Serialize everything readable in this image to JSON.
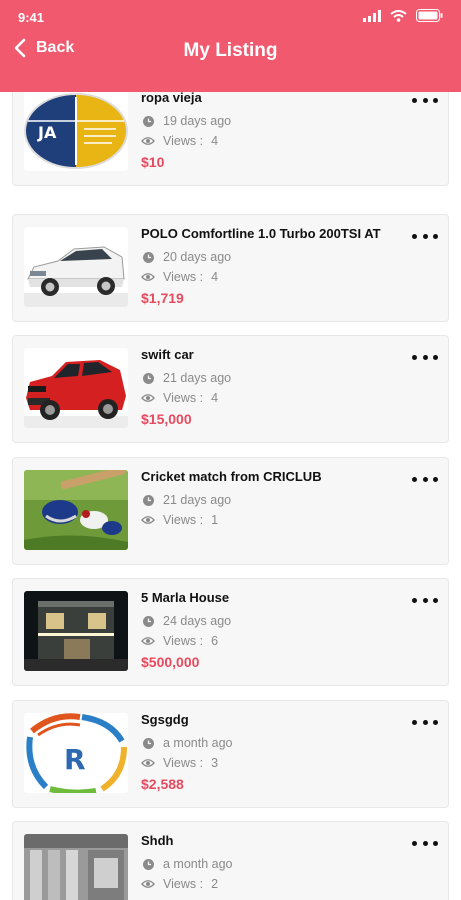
{
  "status_bar": {
    "time": "9:41"
  },
  "header": {
    "back_label": "Back",
    "title": "My Listing"
  },
  "listings": [
    {
      "name": "ropa vieja",
      "posted": "19 days ago",
      "views_label": "Views :",
      "views": "4",
      "price": "$10",
      "image": "ja-logo"
    },
    {
      "name": "POLO Comfortline 1.0 Turbo 200TSI AT",
      "posted": "20 days ago",
      "views_label": "Views :",
      "views": "4",
      "price": "$1,719",
      "image": "white-car"
    },
    {
      "name": "swift car",
      "posted": "21 days ago",
      "views_label": "Views :",
      "views": "4",
      "price": "$15,000",
      "image": "red-car"
    },
    {
      "name": "Cricket match from CRICLUB",
      "posted": "21 days ago",
      "views_label": "Views :",
      "views": "1",
      "price": "",
      "image": "cricket-gear"
    },
    {
      "name": "5 Marla House",
      "posted": "24 days ago",
      "views_label": "Views :",
      "views": "6",
      "price": "$500,000",
      "image": "house"
    },
    {
      "name": "Sgsgdg",
      "posted": "a month ago",
      "views_label": "Views :",
      "views": "3",
      "price": "$2,588",
      "image": "r-logo"
    },
    {
      "name": "Shdh",
      "posted": "a month ago",
      "views_label": "Views :",
      "views": "2",
      "price": "",
      "image": "interior"
    }
  ],
  "colors": {
    "header": "#f15a6e",
    "price": "#e84a5f"
  },
  "icons": {
    "back": "chevron-left-icon",
    "posted": "clock-icon",
    "views": "eye-icon",
    "menu": "more-dots-icon"
  }
}
